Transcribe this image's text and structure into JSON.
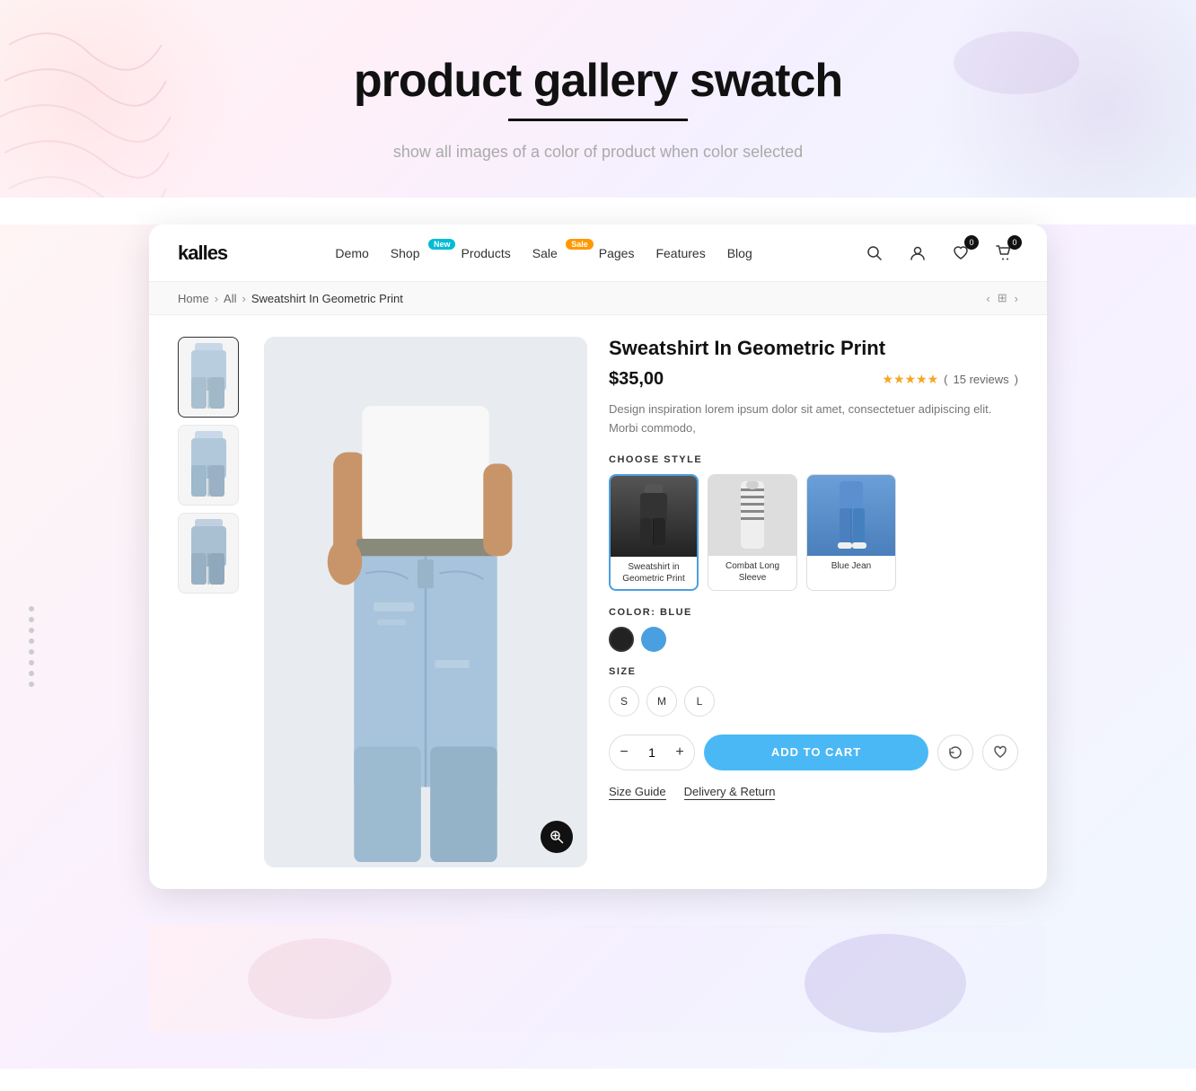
{
  "hero": {
    "title": "product gallery swatch",
    "subtitle": "show all images of a color of product when color selected"
  },
  "navbar": {
    "logo": "kalles",
    "links": [
      {
        "label": "Demo",
        "badge": null
      },
      {
        "label": "Shop",
        "badge": "New",
        "badge_type": "new"
      },
      {
        "label": "Products",
        "badge": null
      },
      {
        "label": "Sale",
        "badge": "Sale",
        "badge_type": "sale"
      },
      {
        "label": "Pages",
        "badge": null
      },
      {
        "label": "Features",
        "badge": null
      },
      {
        "label": "Blog",
        "badge": null
      }
    ],
    "wishlist_count": "0",
    "cart_count": "0"
  },
  "breadcrumb": {
    "home": "Home",
    "all": "All",
    "current": "Sweatshirt In Geometric Print"
  },
  "product": {
    "title": "Sweatshirt In Geometric Print",
    "price": "$35,00",
    "reviews_count": "15 reviews",
    "description": "Design inspiration lorem ipsum dolor sit amet, consectetuer adipiscing elit. Morbi commodo,",
    "choose_style_label": "CHOOSE STYLE",
    "styles": [
      {
        "label": "Sweatshirt in Geometric Print",
        "type": "black"
      },
      {
        "label": "Combat Long Sleeve",
        "type": "stripe"
      },
      {
        "label": "Blue Jean",
        "type": "denim"
      }
    ],
    "color_label": "COLOR: BLUE",
    "colors": [
      {
        "name": "Black",
        "type": "black"
      },
      {
        "name": "Blue",
        "type": "blue"
      }
    ],
    "size_label": "SIZE",
    "sizes": [
      "S",
      "M",
      "L"
    ],
    "quantity": "1",
    "add_to_cart_label": "ADD TO CART",
    "size_guide_label": "Size Guide",
    "delivery_return_label": "Delivery & Return"
  }
}
